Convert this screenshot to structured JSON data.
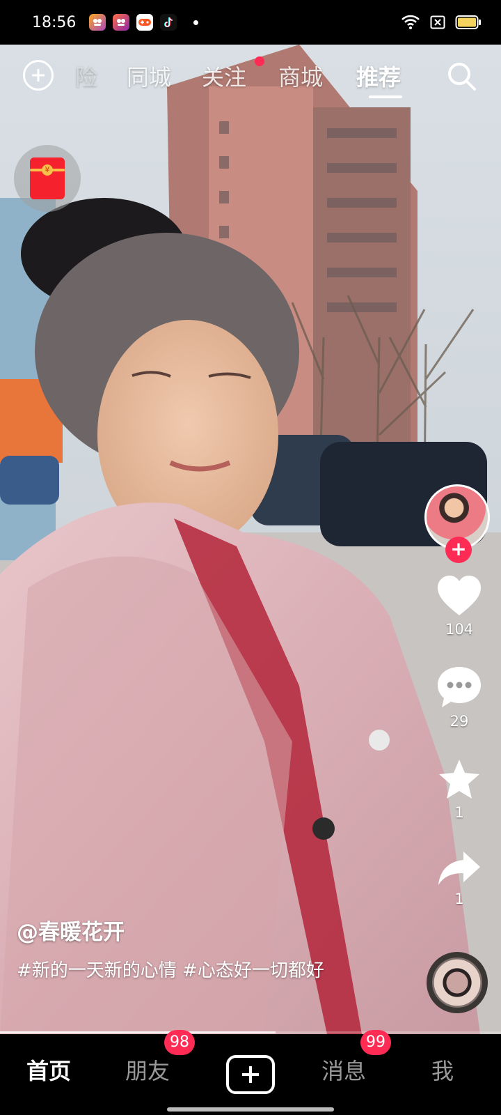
{
  "status_bar": {
    "time": "18:56",
    "notification_apps": [
      "meituan-app-icon",
      "meituan-app-icon",
      "game-app-icon",
      "tiktok-app-icon"
    ],
    "battery_color": "#f4d35e"
  },
  "top_nav": {
    "tabs": [
      {
        "label": "险",
        "partial": true
      },
      {
        "label": "同城"
      },
      {
        "label": "关注",
        "has_dot": true
      },
      {
        "label": "商城"
      },
      {
        "label": "推荐",
        "active": true
      }
    ]
  },
  "actions": {
    "likes": "104",
    "comments": "29",
    "favorites": "1",
    "shares": "1"
  },
  "caption": {
    "author": "@春暖花开",
    "description": "#新的一天新的心情 #心态好一切都好"
  },
  "progress": 0.55,
  "bottom_nav": {
    "home": "首页",
    "friends": "朋友",
    "friends_badge": "98",
    "messages": "消息",
    "messages_badge": "99",
    "me": "我"
  },
  "colors": {
    "accent": "#fe2c55",
    "nav_background": "#000000"
  }
}
